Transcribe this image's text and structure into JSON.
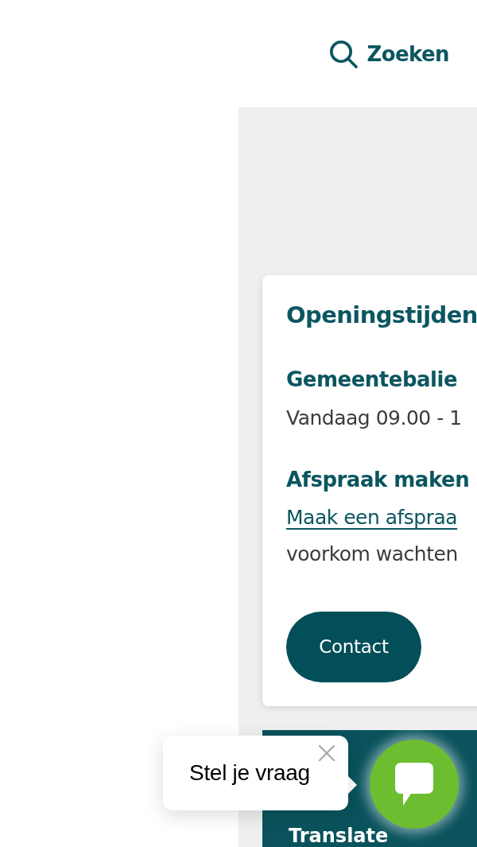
{
  "header": {
    "search": {
      "label": "Zoeken"
    }
  },
  "opening_hours": {
    "title": "Openingstijden",
    "sections": [
      {
        "kind": "hours",
        "heading": "Gemeentebalie",
        "text": "Vandaag 09.00 - 1"
      },
      {
        "kind": "appointment",
        "heading": "Afspraak maken",
        "link": "Maak een afspraa",
        "text": "voorkom wachten"
      }
    ],
    "button": "Contact"
  },
  "translate": {
    "label": "Translate"
  },
  "chat": {
    "prompt": "Stel je vraag"
  }
}
